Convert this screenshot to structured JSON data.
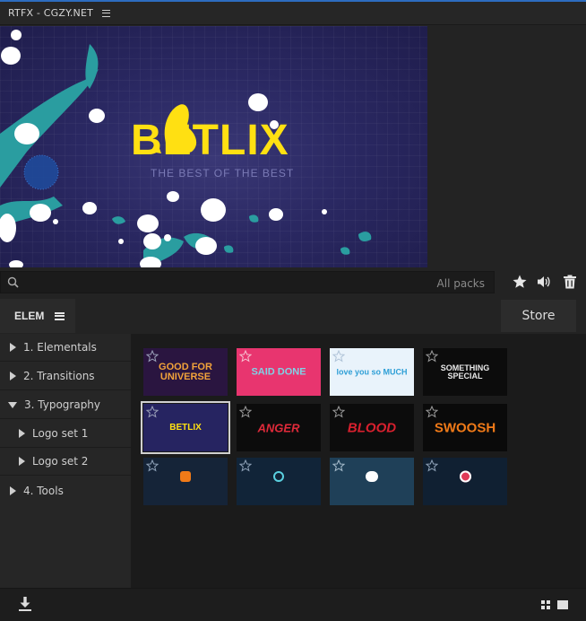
{
  "window": {
    "title": "RTFX - CGZY.NET"
  },
  "preview": {
    "logo_text": "BETLIX",
    "logo_tagline": "THE BEST OF THE BEST"
  },
  "search": {
    "placeholder": "",
    "value": "",
    "packs_label": "All packs"
  },
  "toolbar": {
    "favorites_icon": "star-icon",
    "sound_icon": "speaker-icon",
    "delete_icon": "trash-icon"
  },
  "tabs": {
    "elem_label": "ELEM",
    "store_label": "Store"
  },
  "tree": {
    "items": [
      {
        "label": "1. Elementals",
        "expanded": false
      },
      {
        "label": "2. Transitions",
        "expanded": false
      },
      {
        "label": "3. Typography",
        "expanded": true
      },
      {
        "label": "Logo set 1",
        "expanded": false
      },
      {
        "label": "Logo set 2",
        "expanded": false
      },
      {
        "label": "4. Tools",
        "expanded": false
      }
    ]
  },
  "thumbnails": [
    {
      "text": "GOOD FOR UNIVERSE",
      "bg": "#2a1540",
      "fg": "#f2a33a",
      "selected": false
    },
    {
      "text": "SAID DONE",
      "bg": "#e8356f",
      "fg": "#7fd3e6",
      "selected": false
    },
    {
      "text": "love you so MUCH",
      "bg": "#e9f3fb",
      "fg": "#2e9fd6",
      "selected": false
    },
    {
      "text": "SOMETHING SPECIAL",
      "bg": "#0c0c0c",
      "fg": "#e8e8e8",
      "selected": false
    },
    {
      "text": "BETLIX",
      "bg": "#262461",
      "fg": "#ffe012",
      "selected": true
    },
    {
      "text": "ANGER",
      "bg": "#0c0c0c",
      "fg": "#e02a3a",
      "selected": false
    },
    {
      "text": "BLOOD",
      "bg": "#0c0c0c",
      "fg": "#d8202e",
      "selected": false
    },
    {
      "text": "SWOOSH",
      "bg": "#0a0a0a",
      "fg": "#f07a18",
      "selected": false
    },
    {
      "text": "",
      "bg": "#152438",
      "fg": "#f07a18",
      "selected": false
    },
    {
      "text": "",
      "bg": "#112438",
      "fg": "#5ad0e0",
      "selected": false
    },
    {
      "text": "",
      "bg": "#1f4058",
      "fg": "#ffffff",
      "selected": false
    },
    {
      "text": "",
      "bg": "#102032",
      "fg": "#e03a58",
      "selected": false
    }
  ],
  "bottom": {
    "download_icon": "download-icon",
    "grid_view_icon": "grid-view-icon",
    "list_view_icon": "list-view-icon"
  }
}
